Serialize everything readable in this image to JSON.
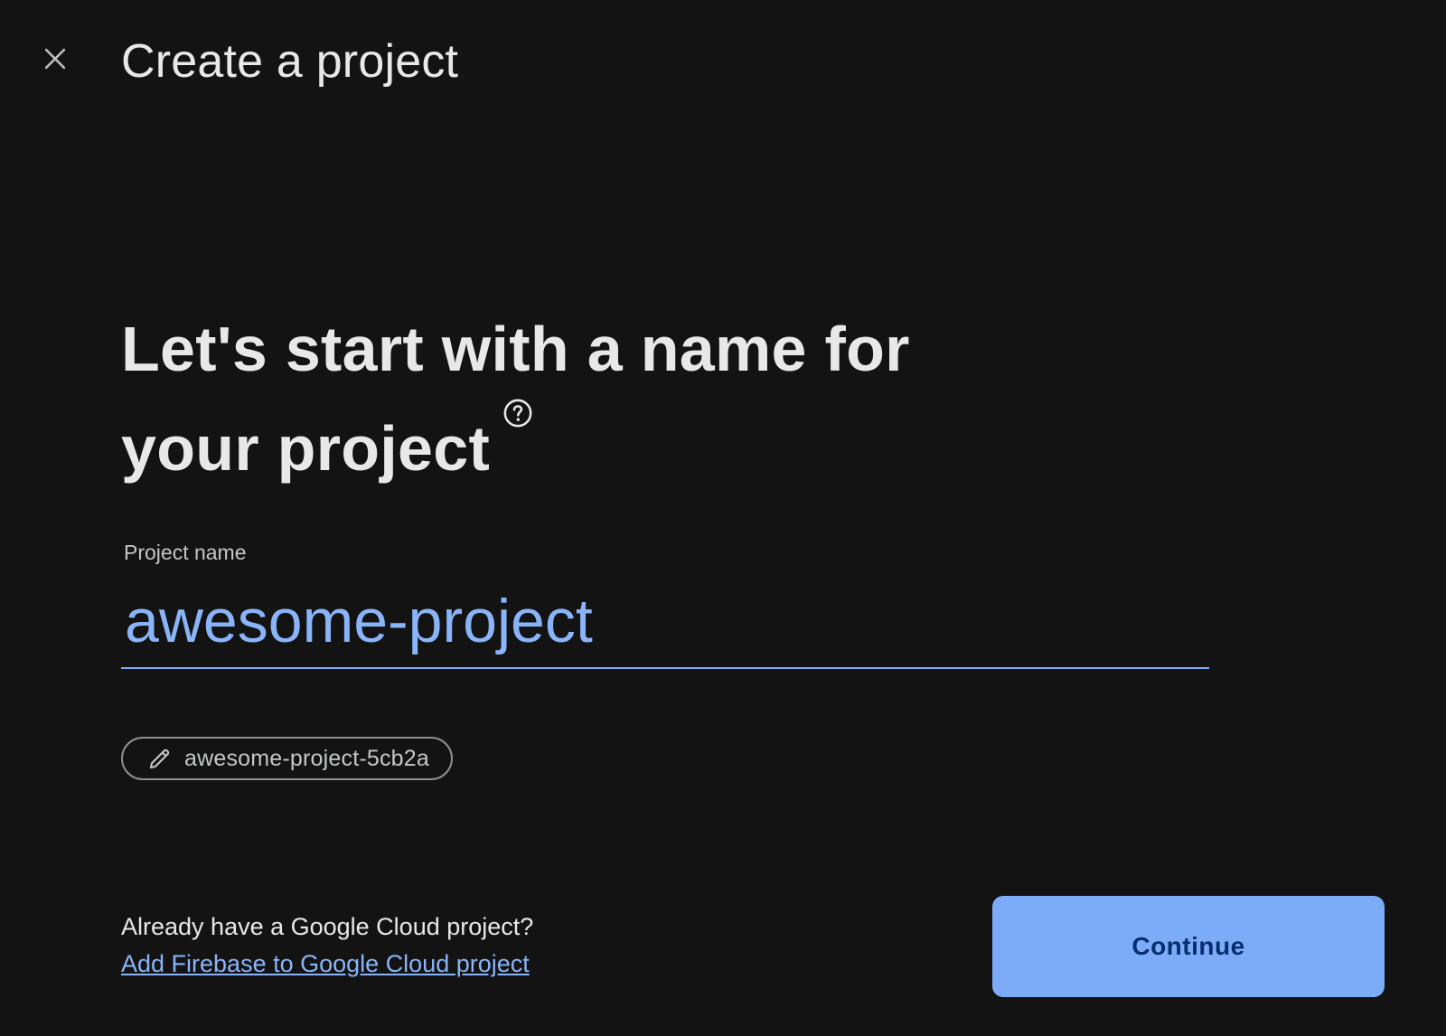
{
  "header": {
    "title": "Create a project",
    "close_icon": "close-icon"
  },
  "main": {
    "headline": "Let's start with a name for your project",
    "help_icon": "help-circle-icon",
    "field": {
      "label": "Project name",
      "value": "awesome-project"
    },
    "project_id_chip": {
      "icon": "pencil-icon",
      "text": "awesome-project-5cb2a"
    }
  },
  "footer": {
    "question": "Already have a Google Cloud project?",
    "link": "Add Firebase to Google Cloud project",
    "continue_label": "Continue"
  },
  "colors": {
    "background": "#131314",
    "accent": "#8ab4f8",
    "button_bg": "#7cacf8",
    "button_text": "#062e6f"
  }
}
